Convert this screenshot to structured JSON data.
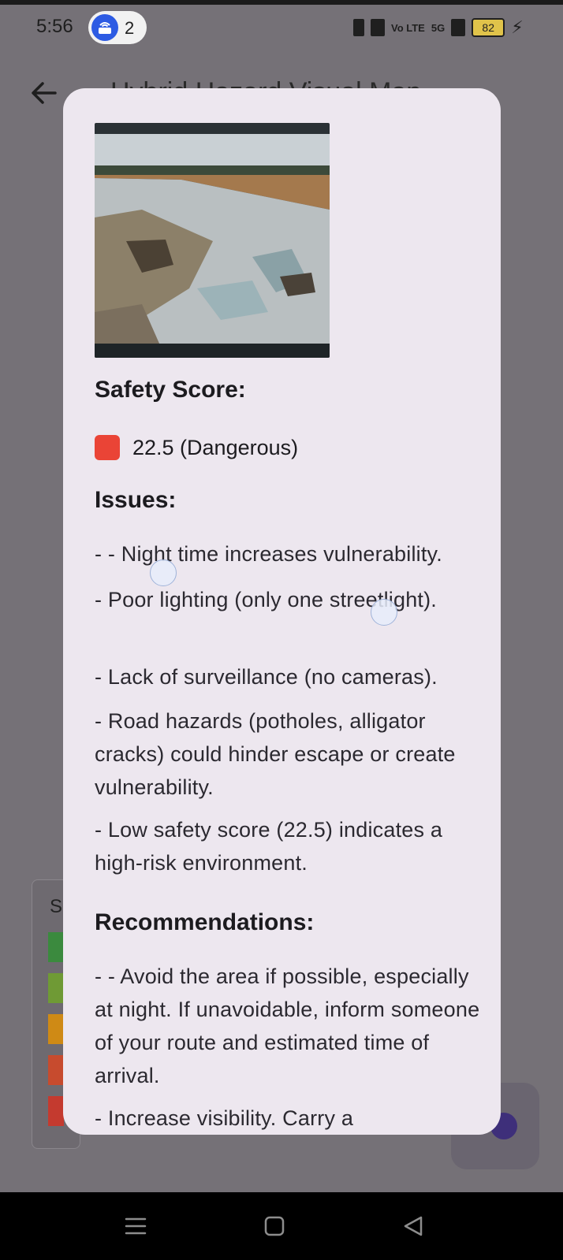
{
  "status_bar": {
    "time": "5:56",
    "hotspot_count": "2",
    "battery": "82",
    "net_5g": "5G",
    "vo_lte": "Vo LTE"
  },
  "app": {
    "title": "Hybrid Hazard Visual Map",
    "legend_initial": "S",
    "legend_colors": [
      "#3b8a3e",
      "#6f9a35",
      "#cf8a15",
      "#c74b2e",
      "#c43a2f"
    ]
  },
  "dialog": {
    "safety_score_heading": "Safety Score:",
    "safety_score_value": "22.5 (Dangerous)",
    "safety_score_color": "#ea4436",
    "issues_heading": "Issues:",
    "issues": [
      "- - Night time increases vulnerability.",
      "-  Poor lighting (only one streetlight).",
      "-  Lack of surveillance (no cameras).",
      "-  Road hazards (potholes, alligator cracks) could hinder escape or create vulnerability.",
      "-  Low safety score (22.5) indicates a high-risk environment."
    ],
    "recommendations_heading": "Recommendations:",
    "recommendations": [
      "- - Avoid the area if possible, especially at night. If unavoidable, inform someone of your route and estimated time of arrival.",
      "-  Increase visibility. Carry a"
    ]
  }
}
